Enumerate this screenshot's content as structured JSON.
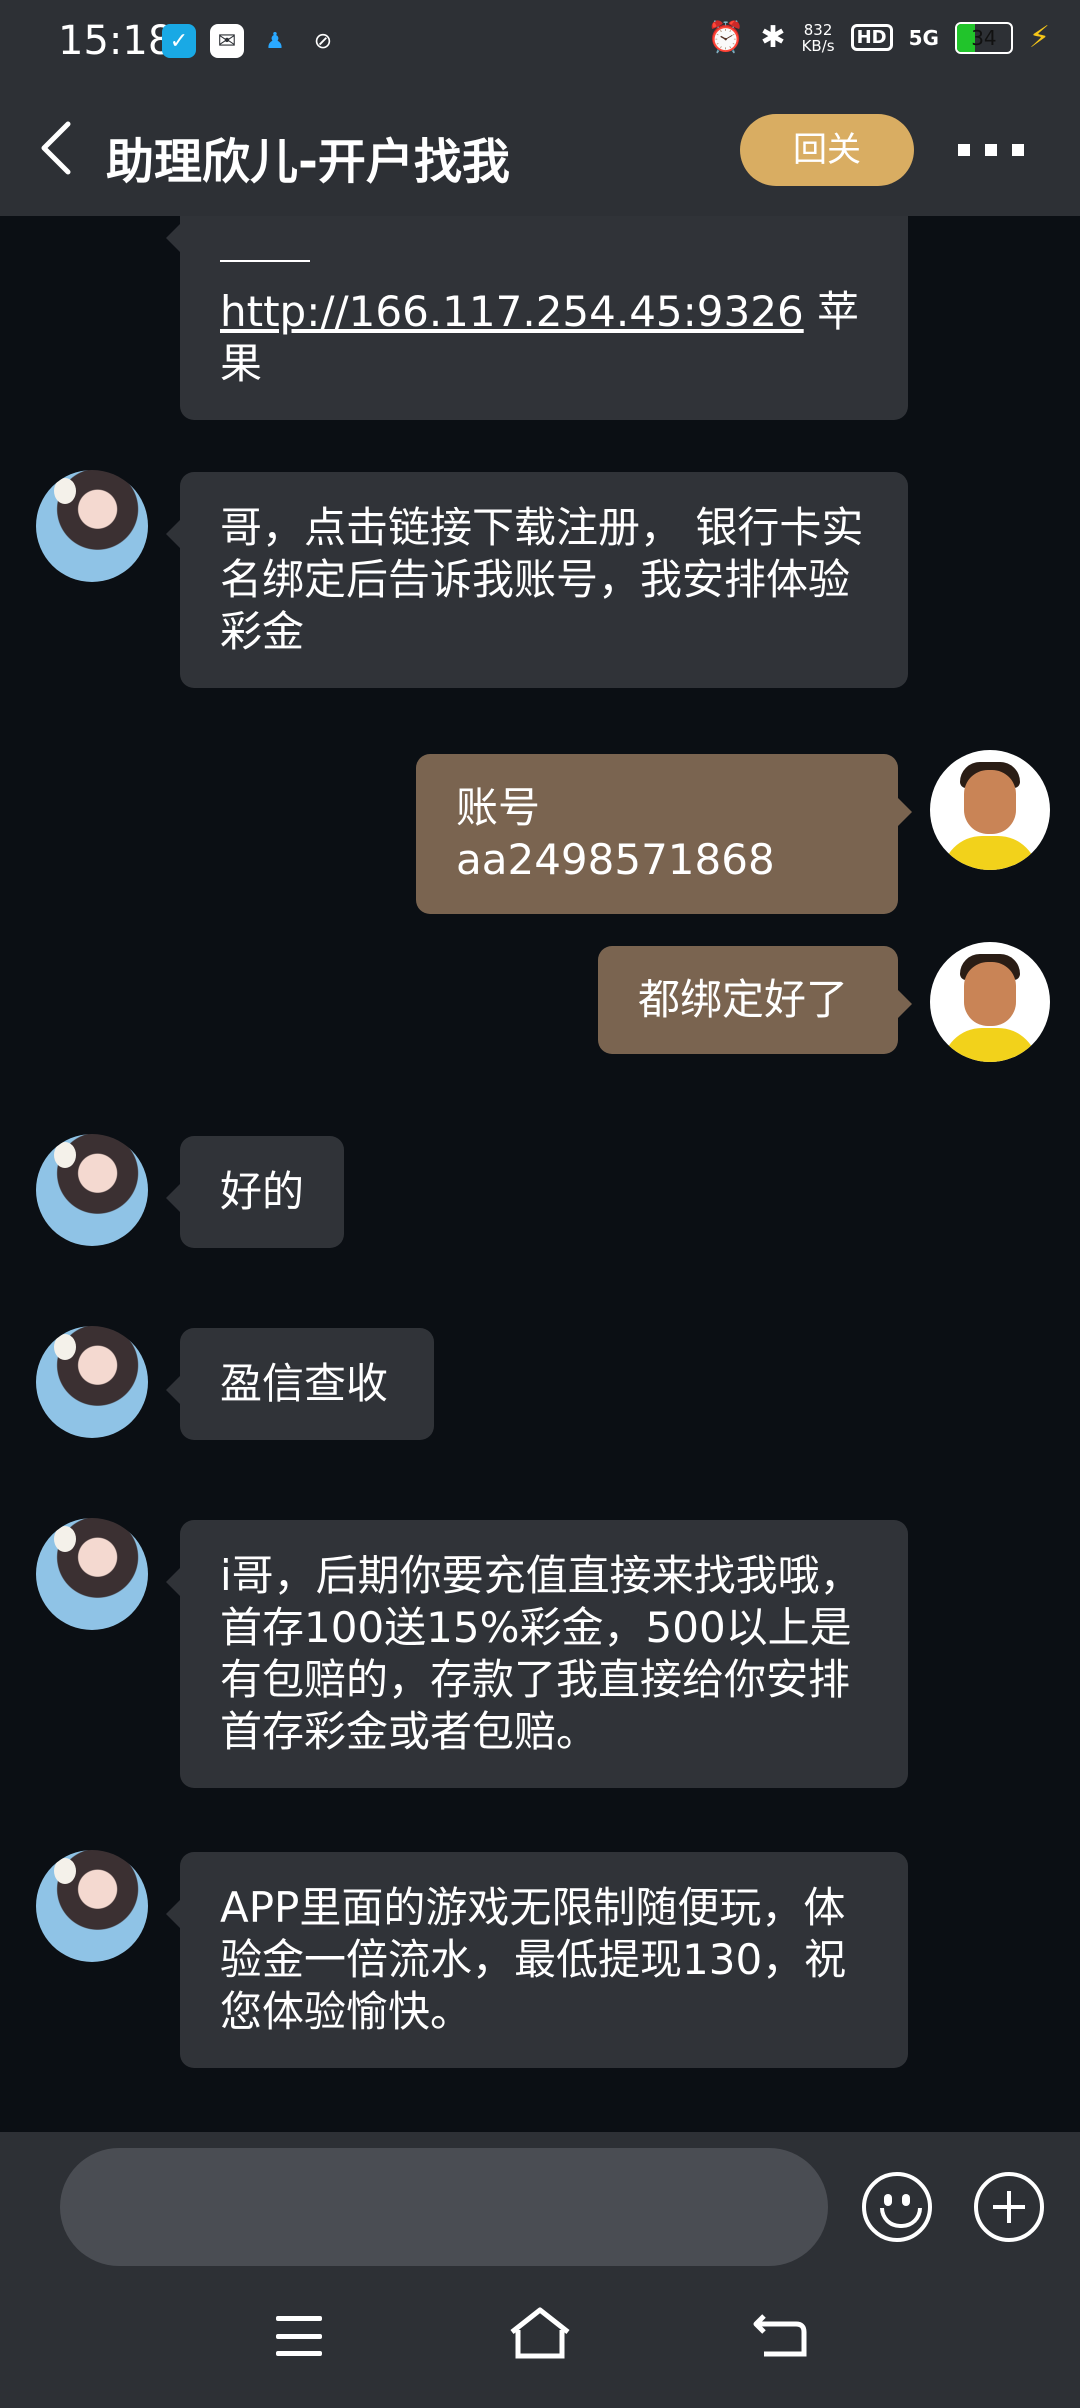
{
  "status_bar": {
    "time": "15:18",
    "net_speed_value": "832",
    "net_speed_unit": "KB/s",
    "hd_label": "HD",
    "signal_label": "5G",
    "battery_level": "34",
    "battery_fraction": 0.34
  },
  "header": {
    "title": "助理欣儿-开户找我",
    "follow_button": "回关"
  },
  "messages": [
    {
      "side": "in",
      "text_link": "http://166.117.254.45:9326",
      "text_suffix": " 苹果"
    },
    {
      "side": "in",
      "text": "哥，点击链接下载注册，  银行卡实名绑定后告诉我账号，我安排体验彩金"
    },
    {
      "side": "out",
      "text": "账号aa2498571868"
    },
    {
      "side": "out",
      "text": "都绑定好了"
    },
    {
      "side": "in",
      "text": "好的"
    },
    {
      "side": "in",
      "text": "盈信查收"
    },
    {
      "side": "in",
      "text": "i哥，后期你要充值直接来找我哦，首存100送15%彩金，500以上是有包赔的，存款了我直接给你安排首存彩金或者包赔。"
    },
    {
      "side": "in",
      "text": "APP里面的游戏无限制随便玩，体验金一倍流水，最低提现130，祝您体验愉快。"
    }
  ],
  "input": {
    "placeholder": ""
  },
  "colors": {
    "bar_bg": "#2d3035",
    "chat_bg": "#0b0f14",
    "incoming_bubble": "#303338",
    "outgoing_bubble": "#7a6450",
    "follow_button": "#d9ad62"
  }
}
